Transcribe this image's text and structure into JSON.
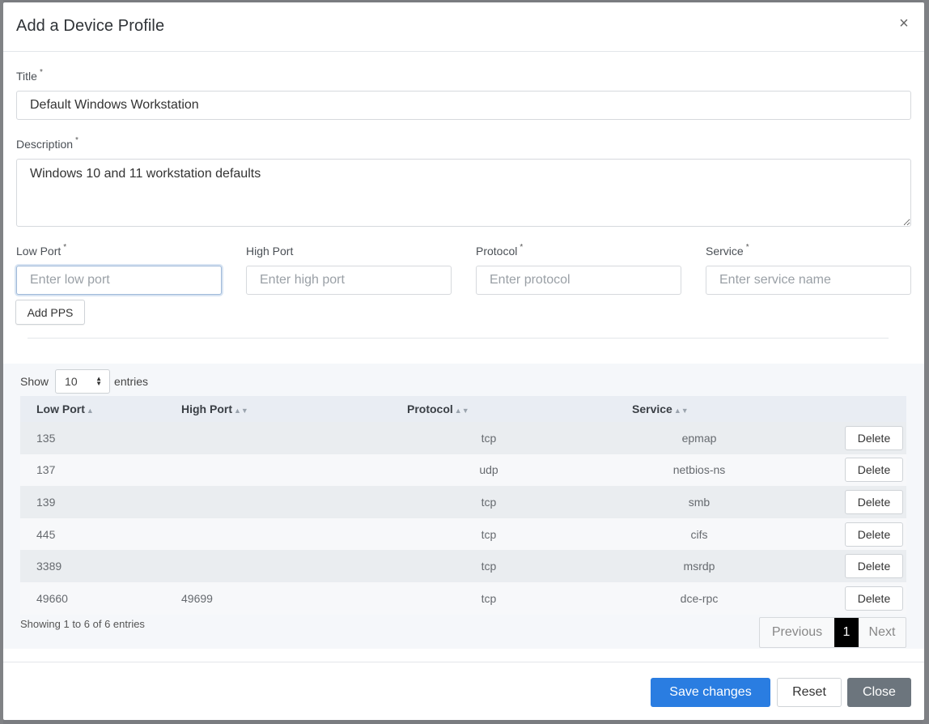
{
  "modal": {
    "title": "Add a Device Profile",
    "close_icon": "close-icon"
  },
  "form": {
    "title_label": "Title",
    "title_value": "Default Windows Workstation",
    "description_label": "Description",
    "description_value": "Windows 10 and 11 workstation defaults",
    "low_port_label": "Low Port",
    "low_port_placeholder": "Enter low port",
    "high_port_label": "High Port",
    "high_port_placeholder": "Enter high port",
    "protocol_label": "Protocol",
    "protocol_placeholder": "Enter protocol",
    "service_label": "Service",
    "service_placeholder": "Enter service name",
    "required_mark": "*",
    "add_button": "Add PPS"
  },
  "table": {
    "show_label": "Show",
    "page_length": "10",
    "entries_label": "entries",
    "columns": [
      "Low Port",
      "High Port",
      "Protocol",
      "Service"
    ],
    "sort_indicators": [
      "▲",
      "▲▼",
      "▲▼",
      "▲▼"
    ],
    "rows": [
      {
        "low": "135",
        "high": "",
        "protocol": "tcp",
        "service": "epmap",
        "action": "Delete"
      },
      {
        "low": "137",
        "high": "",
        "protocol": "udp",
        "service": "netbios-ns",
        "action": "Delete"
      },
      {
        "low": "139",
        "high": "",
        "protocol": "tcp",
        "service": "smb",
        "action": "Delete"
      },
      {
        "low": "445",
        "high": "",
        "protocol": "tcp",
        "service": "cifs",
        "action": "Delete"
      },
      {
        "low": "3389",
        "high": "",
        "protocol": "tcp",
        "service": "msrdp",
        "action": "Delete"
      },
      {
        "low": "49660",
        "high": "49699",
        "protocol": "tcp",
        "service": "dce-rpc",
        "action": "Delete"
      }
    ],
    "info": "Showing 1 to 6 of 6 entries",
    "pagination": {
      "previous": "Previous",
      "current": "1",
      "next": "Next"
    }
  },
  "footer": {
    "save": "Save changes",
    "reset": "Reset",
    "close": "Close"
  },
  "colors": {
    "primary": "#2a7de1",
    "secondary": "#6c757d",
    "active_page": "#000000"
  }
}
